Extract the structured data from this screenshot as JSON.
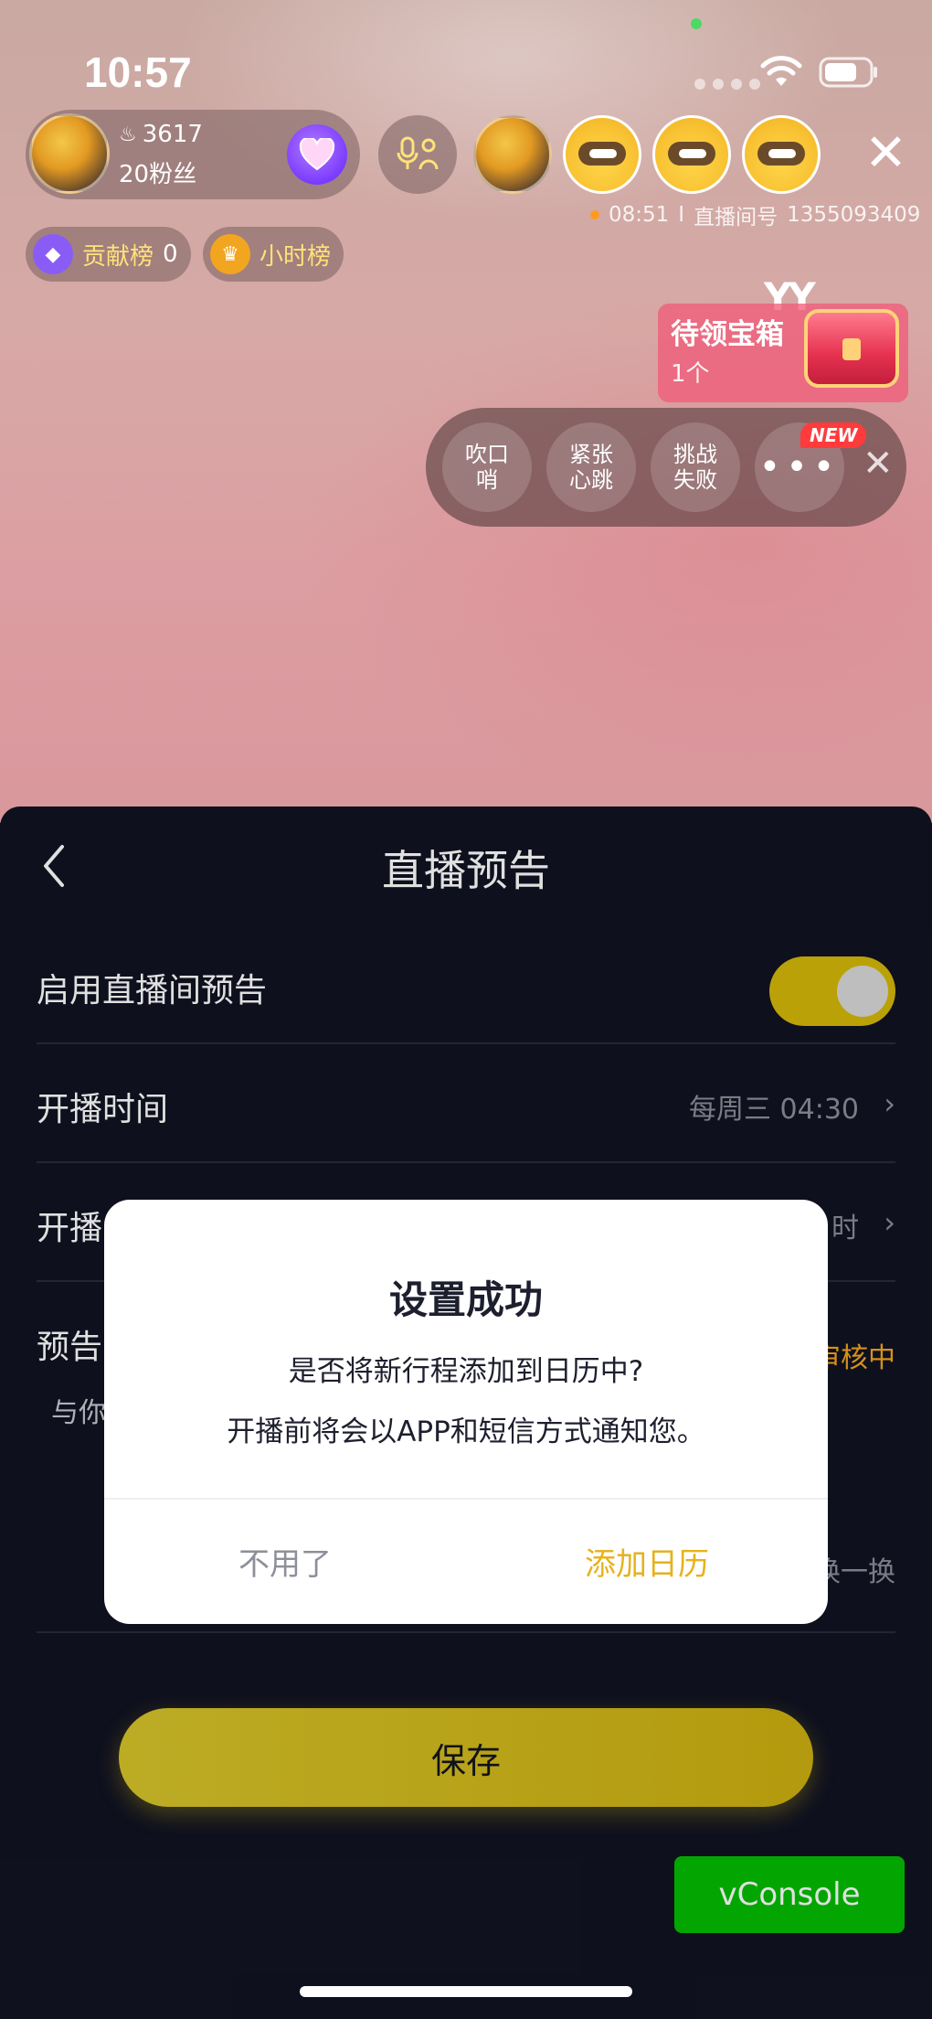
{
  "status_bar": {
    "time": "10:57"
  },
  "host": {
    "heat": "3617",
    "fans": "20粉丝"
  },
  "room": {
    "duration": "08:51",
    "separator": "I",
    "room_label": "直播间号",
    "room_id": "1355093409"
  },
  "ranks": [
    {
      "label": "贡献榜",
      "count": "0"
    },
    {
      "label": "小时榜"
    }
  ],
  "treasure": {
    "title": "待领宝箱",
    "count": "1个",
    "decor_text": "YY"
  },
  "effects": {
    "items": [
      "吹口哨",
      "紧张心跳",
      "挑战失败"
    ],
    "more_glyph": "•••",
    "new_badge": "NEW"
  },
  "sheet": {
    "title": "直播预告",
    "rows": {
      "enable": {
        "label": "启用直播间预告",
        "enabled": true
      },
      "time": {
        "label": "开播时间",
        "value": "每周三 04:30"
      },
      "duration": {
        "label": "开播",
        "value": "时"
      },
      "preview": {
        "label": "预告",
        "status": "审核中",
        "sub": "与你",
        "action": "换一换"
      }
    },
    "save_label": "保存"
  },
  "dialog": {
    "title": "设置成功",
    "line1": "是否将新行程添加到日历中?",
    "line2": "开播前将会以APP和短信方式通知您。",
    "cancel_label": "不用了",
    "confirm_label": "添加日历"
  },
  "vconsole_label": "vConsole",
  "colors": {
    "accent": "#d4b80a",
    "dialog_confirm": "#e6b21b",
    "review": "#f2a51f",
    "vconsole": "#04be02"
  },
  "icons": [
    "flame-icon",
    "heart-icon",
    "mic-icon",
    "close-icon",
    "diamond-icon",
    "crown-icon",
    "back-icon",
    "chevron-right-icon",
    "wifi-icon",
    "battery-icon"
  ]
}
